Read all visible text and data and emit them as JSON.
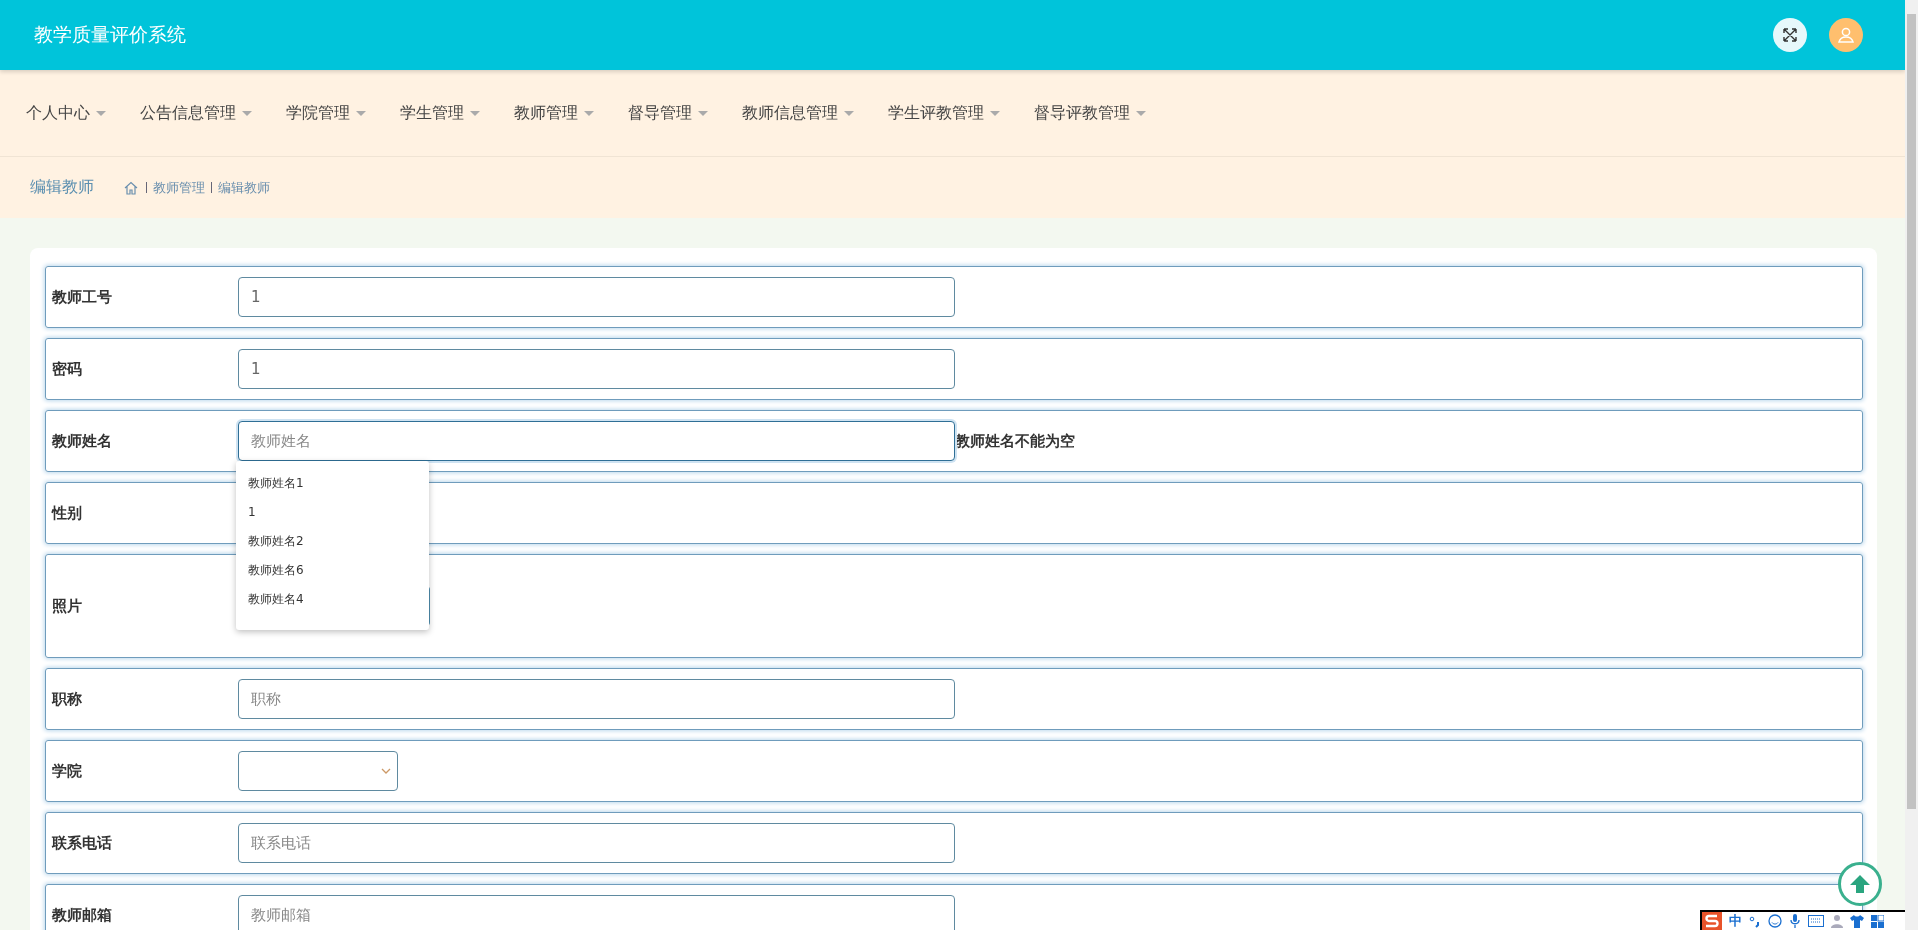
{
  "header": {
    "title": "教学质量评价系统"
  },
  "nav": [
    {
      "label": "个人中心"
    },
    {
      "label": "公告信息管理"
    },
    {
      "label": "学院管理"
    },
    {
      "label": "学生管理"
    },
    {
      "label": "教师管理"
    },
    {
      "label": "督导管理"
    },
    {
      "label": "教师信息管理"
    },
    {
      "label": "学生评教管理"
    },
    {
      "label": "督导评教管理"
    }
  ],
  "breadcrumb": {
    "page_title": "编辑教师",
    "items": [
      "教师管理",
      "编辑教师"
    ]
  },
  "form": {
    "fields": [
      {
        "label": "教师工号",
        "kind": "input",
        "value": "1"
      },
      {
        "label": "密码",
        "kind": "input",
        "value": "1"
      },
      {
        "label": "教师姓名",
        "kind": "input",
        "placeholder": "教师姓名",
        "focused": true,
        "error": "教师姓名不能为空",
        "suggestions": [
          "教师姓名1",
          "1",
          "教师姓名2",
          "教师姓名6",
          "教师姓名4"
        ]
      },
      {
        "label": "性别",
        "kind": "none"
      },
      {
        "label": "照片",
        "kind": "upload"
      },
      {
        "label": "职称",
        "kind": "input",
        "placeholder": "职称"
      },
      {
        "label": "学院",
        "kind": "select"
      },
      {
        "label": "联系电话",
        "kind": "input",
        "placeholder": "联系电话"
      },
      {
        "label": "教师邮箱",
        "kind": "input",
        "placeholder": "教师邮箱"
      }
    ]
  },
  "ime_toolbar": {
    "mode": "中"
  }
}
